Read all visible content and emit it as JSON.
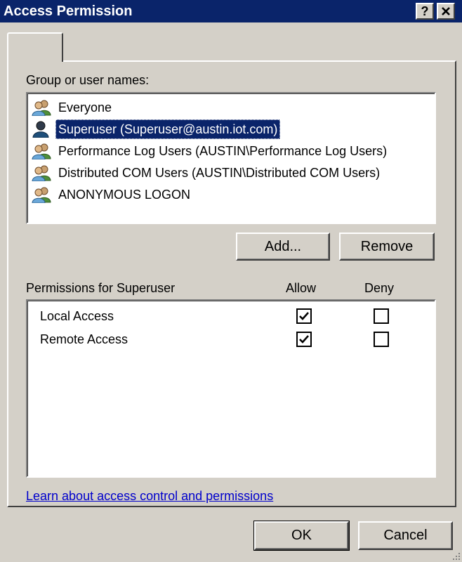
{
  "window": {
    "title": "Access Permission"
  },
  "titlebar": {
    "help_label": "?",
    "close_label": "✕"
  },
  "group_section": {
    "label": "Group or user names:"
  },
  "users": [
    {
      "name": "Everyone",
      "icon": "group-icon",
      "selected": false
    },
    {
      "name": "Superuser (Superuser@austin.iot.com)",
      "icon": "user-icon",
      "selected": true
    },
    {
      "name": "Performance Log Users (AUSTIN\\Performance Log Users)",
      "icon": "group-icon",
      "selected": false
    },
    {
      "name": "Distributed COM Users (AUSTIN\\Distributed COM Users)",
      "icon": "group-icon",
      "selected": false
    },
    {
      "name": "ANONYMOUS LOGON",
      "icon": "group-icon",
      "selected": false
    }
  ],
  "buttons": {
    "add": "Add...",
    "remove": "Remove",
    "ok": "OK",
    "cancel": "Cancel"
  },
  "permissions": {
    "header_label": "Permissions for Superuser",
    "allow_label": "Allow",
    "deny_label": "Deny",
    "rows": [
      {
        "name": "Local Access",
        "allow": true,
        "deny": false
      },
      {
        "name": "Remote Access",
        "allow": true,
        "deny": false
      }
    ]
  },
  "link": {
    "text": "Learn about access control and permissions"
  },
  "colors": {
    "selection": "#0a246a",
    "face": "#d4d0c8",
    "link": "#0000cc"
  }
}
